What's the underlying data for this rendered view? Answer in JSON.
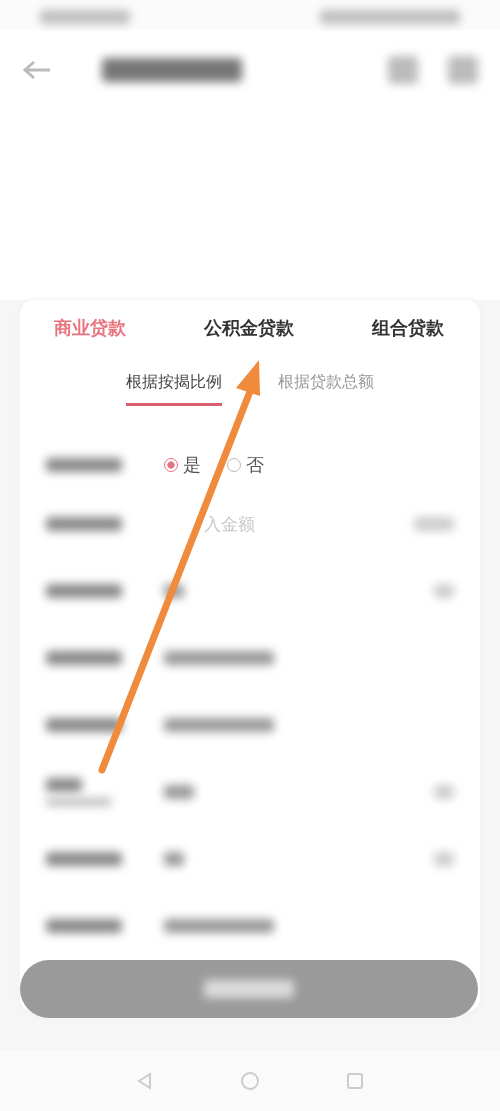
{
  "loan_tabs": [
    {
      "label": "商业贷款",
      "selected": true
    },
    {
      "label": "公积金贷款",
      "selected": false
    },
    {
      "label": "组合贷款",
      "selected": false
    }
  ],
  "mode_tabs": [
    {
      "label": "根据按揭比例",
      "selected": true
    },
    {
      "label": "根据贷款总额",
      "selected": false
    }
  ],
  "form_rows": [
    {
      "kind": "radio",
      "options": [
        {
          "label": "是",
          "selected": true
        },
        {
          "label": "否",
          "selected": false
        }
      ]
    },
    {
      "kind": "input",
      "placeholder": "入金额"
    },
    {
      "kind": "blurred_unit"
    },
    {
      "kind": "blurred"
    },
    {
      "kind": "blurred"
    },
    {
      "kind": "blurred_two_line"
    },
    {
      "kind": "blurred_unit"
    },
    {
      "kind": "blurred"
    }
  ]
}
